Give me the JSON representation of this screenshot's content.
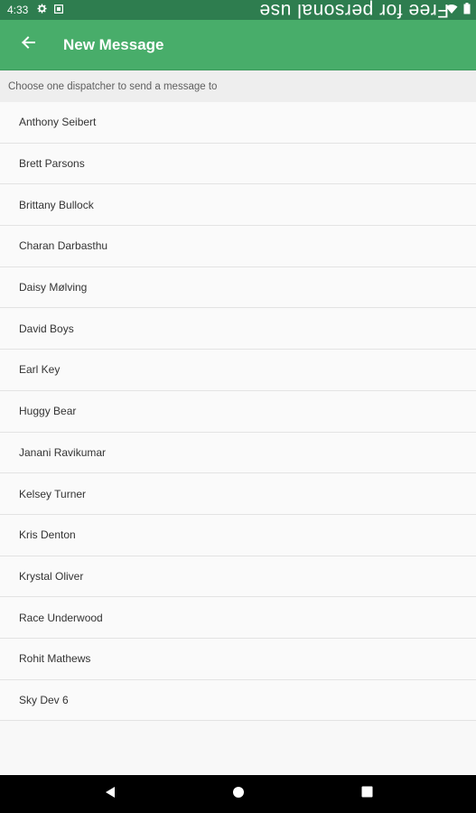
{
  "status_bar": {
    "time": "4:33",
    "icons": [
      "settings-icon",
      "stop-icon",
      "wifi-icon",
      "battery-icon"
    ],
    "watermark": "Free for personal use"
  },
  "app_bar": {
    "back_icon": "arrow-left-icon",
    "title": "New Message",
    "color": "#48ad6a"
  },
  "subheader": {
    "text": "Choose one dispatcher to send a message to"
  },
  "dispatchers": [
    "Anthony Seibert",
    "Brett Parsons",
    "Brittany Bullock",
    "Charan Darbasthu",
    "Daisy Mølving",
    "David Boys",
    "Earl Key",
    "Huggy Bear",
    "Janani Ravikumar",
    "Kelsey Turner",
    "Kris Denton",
    "Krystal Oliver",
    "Race Underwood",
    "Rohit Mathews",
    "Sky Dev 6"
  ],
  "nav_bar": {
    "buttons": [
      "back-triangle-icon",
      "home-circle-icon",
      "recents-square-icon"
    ]
  }
}
